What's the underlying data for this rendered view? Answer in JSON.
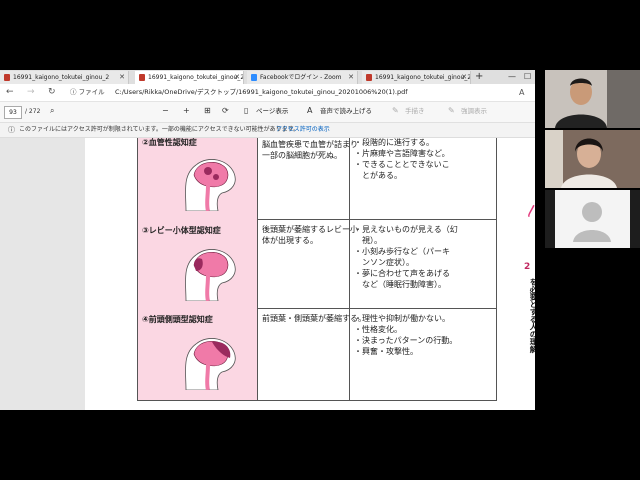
{
  "tabs": [
    {
      "label": "16991_kaigono_tokutei_ginou_2",
      "type": "pdf"
    },
    {
      "label": "16991_kaigono_tokutei_ginou_2",
      "type": "pdf"
    },
    {
      "label": "Facebookでログイン - Zoom",
      "type": "zoom"
    },
    {
      "label": "16991_kaigono_tokutei_ginou_2",
      "type": "pdf"
    }
  ],
  "address": {
    "file_label": "ファイル",
    "url": "C:/Users/Rikka/OneDrive/デスクトップ/16991_kaigono_tokutei_ginou_20201006%20(1).pdf"
  },
  "pdf_toolbar": {
    "page_current": "93",
    "page_total": "/ 272",
    "page_view": "ページ表示",
    "read_aloud": "音声で読み上げる",
    "draw": "手描き",
    "highlight": "強調表示"
  },
  "notice": {
    "text": "このファイルにはアクセス許可が制限されています。一部の機能にアクセスできない可能性があります。",
    "link": "アクセス許可の表示"
  },
  "table_rows": [
    {
      "title": "②血管性認知症",
      "cause": "脳血管疾患で血管が詰まり\n一部の脳細胞が死ぬ。",
      "features": "・段階的に進行する。\n・片麻痺や言語障害など。\n・できることとできないこ\n　とがある。"
    },
    {
      "title": "③レビー小体型認知症",
      "cause": "後頭葉が萎縮するレビー小\n体が出現する。",
      "features": "・見えないものが見える（幻\n　視）。\n・小刻み歩行など（パーキ\n　ンソン症状）。\n・夢に合わせて声をあげる\n　など（睡眠行動障害）。"
    },
    {
      "title": "④前頭側頭型認知症",
      "cause": "前頭葉・側頭葉が萎縮する。",
      "features": "・理性や抑制が働かない。\n・性格変化。\n・決まったパターンの行動。\n・興奮・攻撃性。"
    }
  ],
  "side_label": "を必要とする人の理解",
  "side_number": "2",
  "colors": {
    "pink_cell": "#fbd7e3",
    "brain_pink": "#f07aa8",
    "brain_dark": "#9a2a5e",
    "accent": "#e23a7d"
  }
}
